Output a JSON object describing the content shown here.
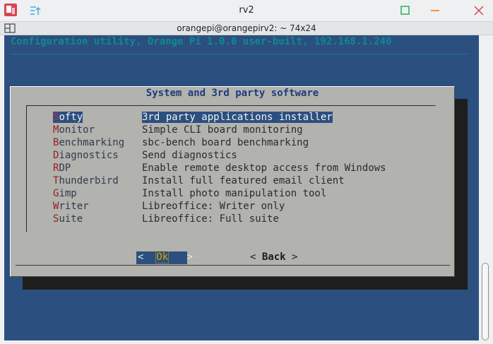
{
  "window": {
    "title": "rv2",
    "tab_title": "orangepi@orangepirv2: ~ 74x24",
    "icons": [
      "app-icon",
      "menu-lines-icon",
      "maximize-icon",
      "minimize-icon",
      "close-icon",
      "split-view-icon"
    ]
  },
  "terminal": {
    "backtitle": "Configuration utility, Orange Pi 1.0.0 user-built, 192.168.1.240",
    "dialog": {
      "title": "System and 3rd party software",
      "items": [
        {
          "hotkey": "S",
          "rest": "ofty",
          "description": "3rd party applications installer",
          "selected": true
        },
        {
          "hotkey": "M",
          "rest": "onitor",
          "description": "Simple CLI board monitoring",
          "selected": false
        },
        {
          "hotkey": "B",
          "rest": "enchmarking",
          "description": "sbc-bench board benchmarking",
          "selected": false
        },
        {
          "hotkey": "D",
          "rest": "iagnostics",
          "description": "Send diagnostics",
          "selected": false
        },
        {
          "hotkey": "R",
          "rest": "DP",
          "description": "Enable remote desktop access from Windows",
          "selected": false
        },
        {
          "hotkey": "T",
          "rest": "hunderbird",
          "description": "Install full featured email client",
          "selected": false
        },
        {
          "hotkey": "G",
          "rest": "imp",
          "description": "Install photo manipulation tool",
          "selected": false
        },
        {
          "hotkey": "W",
          "rest": "riter",
          "description": "Libreoffice: Writer only",
          "selected": false
        },
        {
          "hotkey": "S",
          "rest": "uite",
          "description": "Libreoffice: Full suite",
          "selected": false
        }
      ],
      "ok_left": "<",
      "ok_label": "Ok",
      "ok_right": ">",
      "back_left": "<",
      "back_label": "Back",
      "back_right": ">"
    }
  },
  "colors": {
    "terminal_bg": "#2b4f7f",
    "dialog_bg": "#b2b2ae",
    "hotkey": "#9b1c1c",
    "title": "#1f3c7c"
  }
}
